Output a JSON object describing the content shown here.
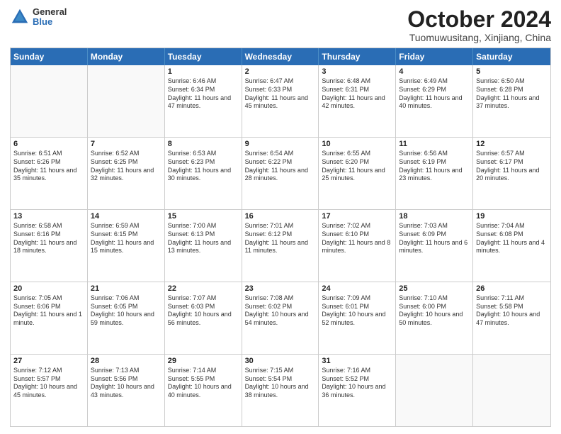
{
  "header": {
    "logo": {
      "general": "General",
      "blue": "Blue"
    },
    "title": "October 2024",
    "location": "Tuomuwusitang, Xinjiang, China"
  },
  "days": [
    "Sunday",
    "Monday",
    "Tuesday",
    "Wednesday",
    "Thursday",
    "Friday",
    "Saturday"
  ],
  "weeks": [
    [
      {
        "day": "",
        "content": ""
      },
      {
        "day": "",
        "content": ""
      },
      {
        "day": "1",
        "content": "Sunrise: 6:46 AM\nSunset: 6:34 PM\nDaylight: 11 hours and 47 minutes."
      },
      {
        "day": "2",
        "content": "Sunrise: 6:47 AM\nSunset: 6:33 PM\nDaylight: 11 hours and 45 minutes."
      },
      {
        "day": "3",
        "content": "Sunrise: 6:48 AM\nSunset: 6:31 PM\nDaylight: 11 hours and 42 minutes."
      },
      {
        "day": "4",
        "content": "Sunrise: 6:49 AM\nSunset: 6:29 PM\nDaylight: 11 hours and 40 minutes."
      },
      {
        "day": "5",
        "content": "Sunrise: 6:50 AM\nSunset: 6:28 PM\nDaylight: 11 hours and 37 minutes."
      }
    ],
    [
      {
        "day": "6",
        "content": "Sunrise: 6:51 AM\nSunset: 6:26 PM\nDaylight: 11 hours and 35 minutes."
      },
      {
        "day": "7",
        "content": "Sunrise: 6:52 AM\nSunset: 6:25 PM\nDaylight: 11 hours and 32 minutes."
      },
      {
        "day": "8",
        "content": "Sunrise: 6:53 AM\nSunset: 6:23 PM\nDaylight: 11 hours and 30 minutes."
      },
      {
        "day": "9",
        "content": "Sunrise: 6:54 AM\nSunset: 6:22 PM\nDaylight: 11 hours and 28 minutes."
      },
      {
        "day": "10",
        "content": "Sunrise: 6:55 AM\nSunset: 6:20 PM\nDaylight: 11 hours and 25 minutes."
      },
      {
        "day": "11",
        "content": "Sunrise: 6:56 AM\nSunset: 6:19 PM\nDaylight: 11 hours and 23 minutes."
      },
      {
        "day": "12",
        "content": "Sunrise: 6:57 AM\nSunset: 6:17 PM\nDaylight: 11 hours and 20 minutes."
      }
    ],
    [
      {
        "day": "13",
        "content": "Sunrise: 6:58 AM\nSunset: 6:16 PM\nDaylight: 11 hours and 18 minutes."
      },
      {
        "day": "14",
        "content": "Sunrise: 6:59 AM\nSunset: 6:15 PM\nDaylight: 11 hours and 15 minutes."
      },
      {
        "day": "15",
        "content": "Sunrise: 7:00 AM\nSunset: 6:13 PM\nDaylight: 11 hours and 13 minutes."
      },
      {
        "day": "16",
        "content": "Sunrise: 7:01 AM\nSunset: 6:12 PM\nDaylight: 11 hours and 11 minutes."
      },
      {
        "day": "17",
        "content": "Sunrise: 7:02 AM\nSunset: 6:10 PM\nDaylight: 11 hours and 8 minutes."
      },
      {
        "day": "18",
        "content": "Sunrise: 7:03 AM\nSunset: 6:09 PM\nDaylight: 11 hours and 6 minutes."
      },
      {
        "day": "19",
        "content": "Sunrise: 7:04 AM\nSunset: 6:08 PM\nDaylight: 11 hours and 4 minutes."
      }
    ],
    [
      {
        "day": "20",
        "content": "Sunrise: 7:05 AM\nSunset: 6:06 PM\nDaylight: 11 hours and 1 minute."
      },
      {
        "day": "21",
        "content": "Sunrise: 7:06 AM\nSunset: 6:05 PM\nDaylight: 10 hours and 59 minutes."
      },
      {
        "day": "22",
        "content": "Sunrise: 7:07 AM\nSunset: 6:03 PM\nDaylight: 10 hours and 56 minutes."
      },
      {
        "day": "23",
        "content": "Sunrise: 7:08 AM\nSunset: 6:02 PM\nDaylight: 10 hours and 54 minutes."
      },
      {
        "day": "24",
        "content": "Sunrise: 7:09 AM\nSunset: 6:01 PM\nDaylight: 10 hours and 52 minutes."
      },
      {
        "day": "25",
        "content": "Sunrise: 7:10 AM\nSunset: 6:00 PM\nDaylight: 10 hours and 50 minutes."
      },
      {
        "day": "26",
        "content": "Sunrise: 7:11 AM\nSunset: 5:58 PM\nDaylight: 10 hours and 47 minutes."
      }
    ],
    [
      {
        "day": "27",
        "content": "Sunrise: 7:12 AM\nSunset: 5:57 PM\nDaylight: 10 hours and 45 minutes."
      },
      {
        "day": "28",
        "content": "Sunrise: 7:13 AM\nSunset: 5:56 PM\nDaylight: 10 hours and 43 minutes."
      },
      {
        "day": "29",
        "content": "Sunrise: 7:14 AM\nSunset: 5:55 PM\nDaylight: 10 hours and 40 minutes."
      },
      {
        "day": "30",
        "content": "Sunrise: 7:15 AM\nSunset: 5:54 PM\nDaylight: 10 hours and 38 minutes."
      },
      {
        "day": "31",
        "content": "Sunrise: 7:16 AM\nSunset: 5:52 PM\nDaylight: 10 hours and 36 minutes."
      },
      {
        "day": "",
        "content": ""
      },
      {
        "day": "",
        "content": ""
      }
    ]
  ]
}
